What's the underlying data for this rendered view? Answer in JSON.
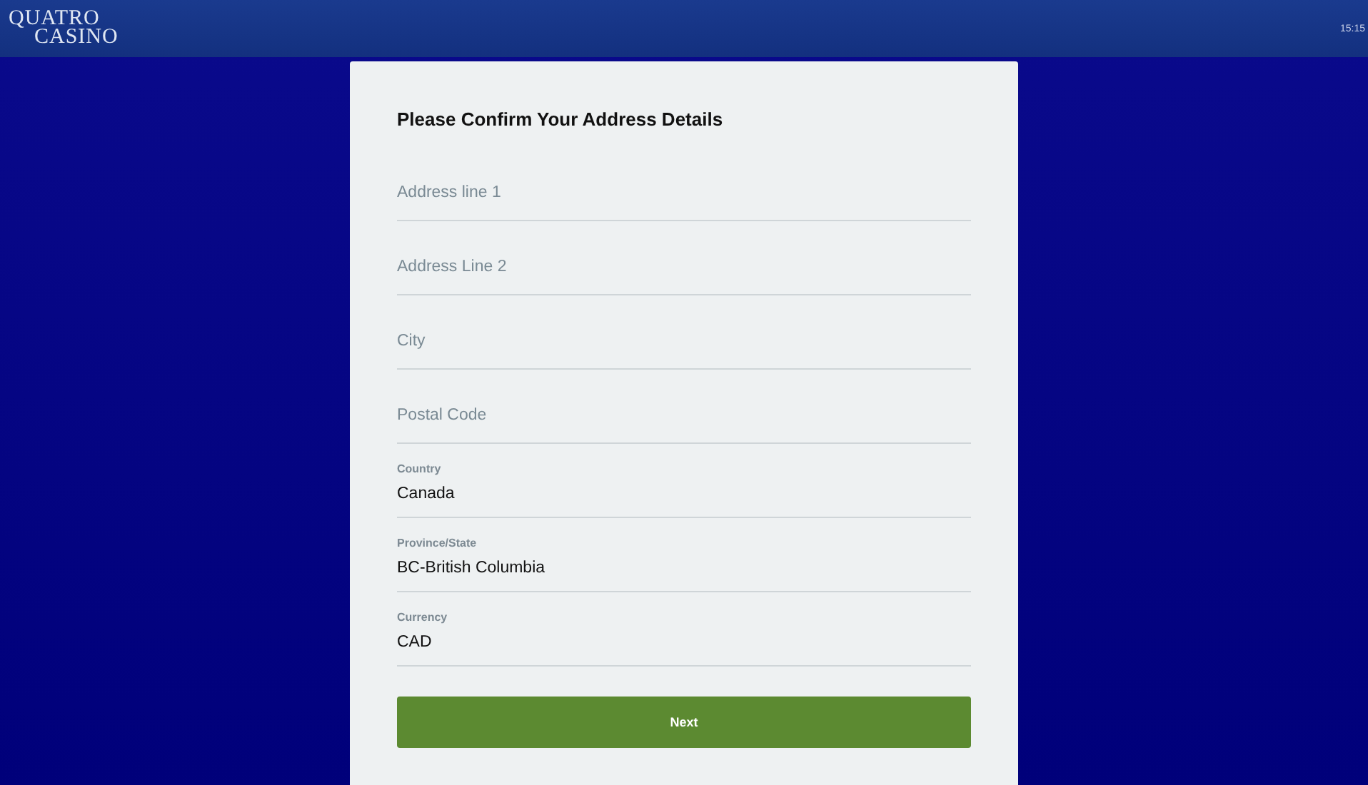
{
  "header": {
    "logo": [
      "QUATRO",
      "CASINO"
    ],
    "time": "15:15"
  },
  "form": {
    "title": "Please Confirm Your Address Details",
    "fields": [
      {
        "kind": "input",
        "placeholder": "Address line 1"
      },
      {
        "kind": "input",
        "placeholder": "Address Line 2"
      },
      {
        "kind": "input",
        "placeholder": "City"
      },
      {
        "kind": "input",
        "placeholder": "Postal Code"
      },
      {
        "kind": "select",
        "label": "Country",
        "value": "Canada"
      },
      {
        "kind": "select",
        "label": "Province/State",
        "value": "BC-British Columbia"
      },
      {
        "kind": "select",
        "label": "Currency",
        "value": "CAD"
      }
    ],
    "button": "Next"
  }
}
